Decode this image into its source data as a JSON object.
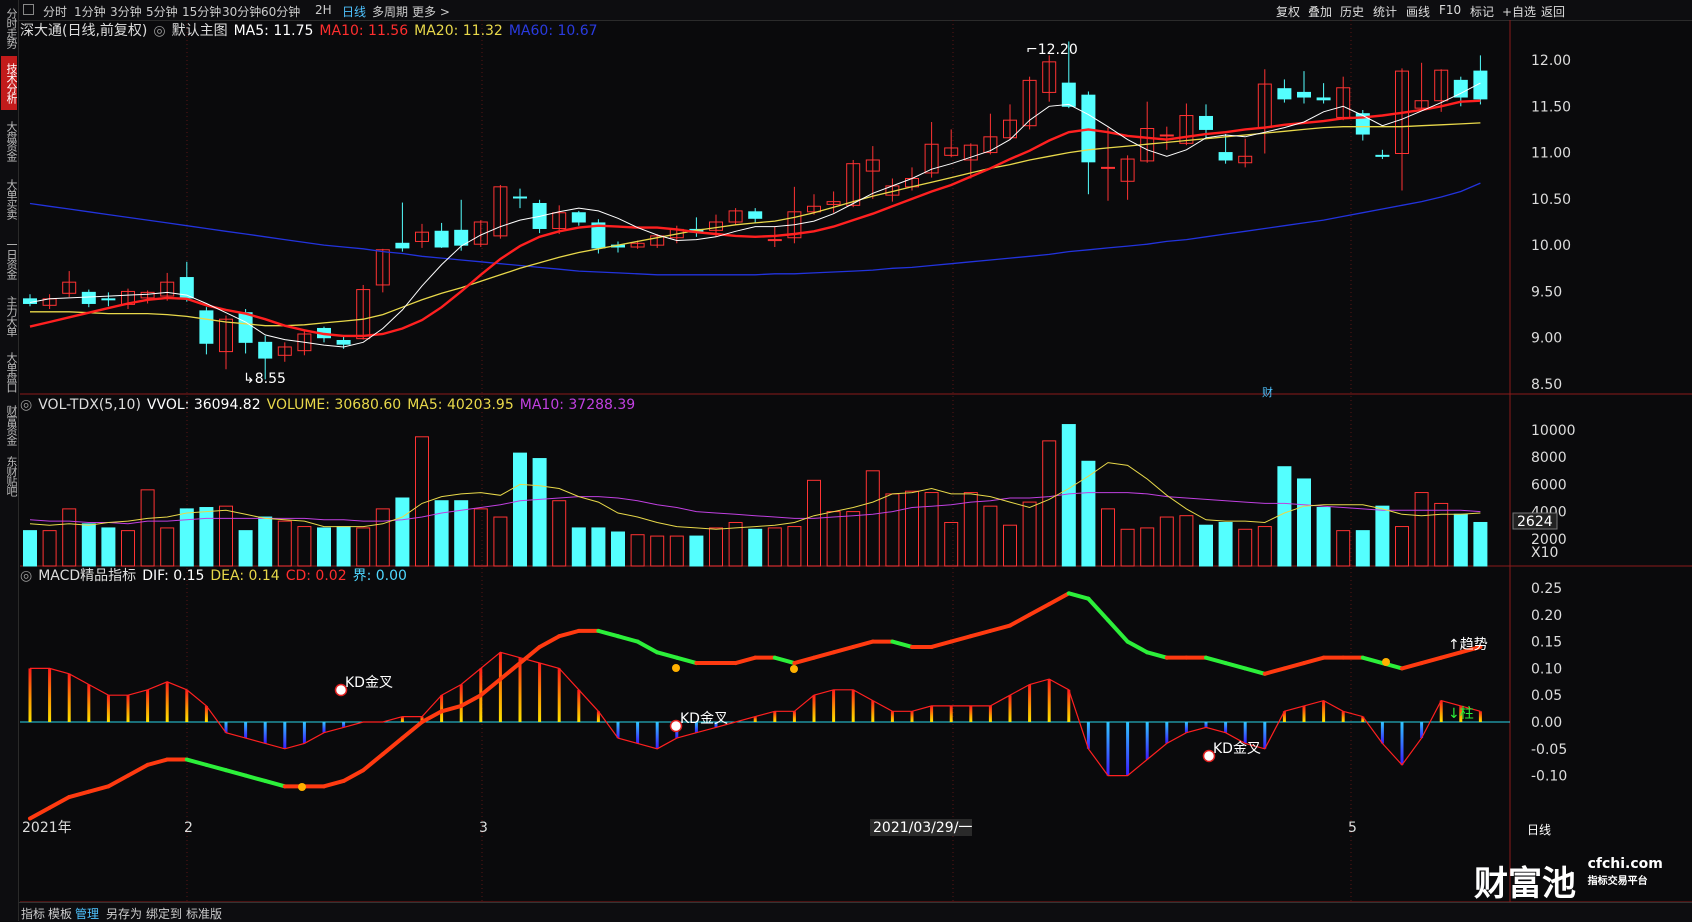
{
  "sidebar": [
    "分时走势",
    "技术分析",
    "大盘资金",
    "大单买卖",
    "一日资金",
    "主力大单",
    "大单盘口",
    "财富资金",
    "东财贴吧"
  ],
  "toolbar": {
    "periods": [
      "分时",
      "1分钟",
      "3分钟",
      "5分钟",
      "15分钟",
      "30分钟",
      "60分钟",
      "2H",
      "日线",
      "多周期",
      "更多 >"
    ],
    "selected": "日线",
    "right": [
      "复权",
      "叠加",
      "历史",
      "统计",
      "画线",
      "F10",
      "标记",
      "+自选",
      "返回"
    ]
  },
  "main_header": {
    "stock": "深大通(日线,前复权)",
    "template": "默认主图",
    "ma5": "MA5: 11.75",
    "ma10": "MA10: 11.56",
    "ma20": "MA20: 11.32",
    "ma60": "MA60: 10.67"
  },
  "vol_header": {
    "name": "VOL-TDX(5,10)",
    "vvol": "VVOL: 36094.82",
    "volume": "VOLUME: 30680.60",
    "ma5": "MA5: 40203.95",
    "ma10": "MA10: 37288.39"
  },
  "macd_header": {
    "name": "MACD精品指标",
    "dif": "DIF: 0.15",
    "dea": "DEA: 0.14",
    "cd": "CD: 0.02",
    "jie": "界: 0.00"
  },
  "price_axis": [
    "12.00",
    "11.50",
    "11.00",
    "10.50",
    "10.00",
    "9.50",
    "9.00",
    "8.50"
  ],
  "vol_axis": [
    "10000",
    "8000",
    "6000",
    "4000",
    "2000"
  ],
  "vol_cursor": "2624",
  "vol_unit": "X10",
  "macd_axis": [
    "0.25",
    "0.20",
    "0.15",
    "0.10",
    "0.05",
    "0.00",
    "-0.05",
    "-0.10"
  ],
  "annotations": {
    "high": "12.20",
    "low": "8.55",
    "cai": "财",
    "kd": "KD金叉",
    "trend": "↑趋势",
    "bar": "↓柱"
  },
  "x_labels": [
    "2021年",
    "2",
    "3",
    "2021/03/29/一",
    "5"
  ],
  "x_right": "日线",
  "bottom_tabs": [
    "指标",
    "模板",
    "管理",
    "另存为",
    "绑定到",
    "标准版"
  ],
  "bottom_selected": "管理",
  "logo": {
    "main": "财富池",
    "domain": "cfchi.com",
    "sub": "指标交易平台"
  },
  "colors": {
    "up": "#ff3333",
    "down": "#54ffff",
    "ma5": "#ffffff",
    "ma10": "#ff2020",
    "ma20": "#e8d84a",
    "ma60": "#2233dd",
    "vma5": "#e8d84a",
    "vma10": "#c040e0"
  },
  "chart_data": {
    "type": "candlestick",
    "candles": [
      [
        9.42,
        9.37,
        9.47,
        9.34
      ],
      [
        9.35,
        9.42,
        9.47,
        9.31
      ],
      [
        9.48,
        9.6,
        9.72,
        9.44
      ],
      [
        9.49,
        9.37,
        9.52,
        9.33
      ],
      [
        9.42,
        9.41,
        9.49,
        9.34
      ],
      [
        9.36,
        9.5,
        9.53,
        9.31
      ],
      [
        9.43,
        9.49,
        9.51,
        9.37
      ],
      [
        9.45,
        9.6,
        9.7,
        9.4
      ],
      [
        9.65,
        9.43,
        9.82,
        9.39
      ],
      [
        9.29,
        8.94,
        9.33,
        8.82
      ],
      [
        8.85,
        9.2,
        9.24,
        8.66
      ],
      [
        9.27,
        8.95,
        9.31,
        8.83
      ],
      [
        8.95,
        8.78,
        9.02,
        8.55
      ],
      [
        8.81,
        8.9,
        8.95,
        8.74
      ],
      [
        8.86,
        9.04,
        9.09,
        8.81
      ],
      [
        9.1,
        9.0,
        9.12,
        8.95
      ],
      [
        8.97,
        8.93,
        9.02,
        8.88
      ],
      [
        8.99,
        9.52,
        9.57,
        8.98
      ],
      [
        9.57,
        9.95,
        9.96,
        9.49
      ],
      [
        10.02,
        9.97,
        10.46,
        9.93
      ],
      [
        10.04,
        10.14,
        10.23,
        9.97
      ],
      [
        10.15,
        9.98,
        10.24,
        9.97
      ],
      [
        10.16,
        10.0,
        10.49,
        9.94
      ],
      [
        10.01,
        10.25,
        10.27,
        9.98
      ],
      [
        10.1,
        10.63,
        10.65,
        10.07
      ],
      [
        10.52,
        10.51,
        10.61,
        10.4
      ],
      [
        10.45,
        10.18,
        10.49,
        10.13
      ],
      [
        10.18,
        10.35,
        10.43,
        10.12
      ],
      [
        10.35,
        10.25,
        10.37,
        10.21
      ],
      [
        10.24,
        9.97,
        10.28,
        9.91
      ],
      [
        10.0,
        9.98,
        10.04,
        9.92
      ],
      [
        9.98,
        10.02,
        10.05,
        9.96
      ],
      [
        10.0,
        10.1,
        10.12,
        9.97
      ],
      [
        10.08,
        10.17,
        10.21,
        10.02
      ],
      [
        10.17,
        10.14,
        10.3,
        10.09
      ],
      [
        10.16,
        10.25,
        10.33,
        10.09
      ],
      [
        10.25,
        10.37,
        10.4,
        10.22
      ],
      [
        10.36,
        10.29,
        10.4,
        10.24
      ],
      [
        10.06,
        10.06,
        10.2,
        9.98
      ],
      [
        10.08,
        10.36,
        10.63,
        10.02
      ],
      [
        10.36,
        10.42,
        10.55,
        10.33
      ],
      [
        10.44,
        10.47,
        10.58,
        10.35
      ],
      [
        10.43,
        10.88,
        10.92,
        10.41
      ],
      [
        10.8,
        10.92,
        11.07,
        10.5
      ],
      [
        10.54,
        10.64,
        10.72,
        10.47
      ],
      [
        10.63,
        10.72,
        10.84,
        10.59
      ],
      [
        10.78,
        11.09,
        11.33,
        10.73
      ],
      [
        10.97,
        11.05,
        11.25,
        10.95
      ],
      [
        10.92,
        11.08,
        11.1,
        10.72
      ],
      [
        11.0,
        11.17,
        11.42,
        10.98
      ],
      [
        11.16,
        11.35,
        11.52,
        11.14
      ],
      [
        11.29,
        11.78,
        11.82,
        11.25
      ],
      [
        11.65,
        11.98,
        12.05,
        11.55
      ],
      [
        11.75,
        11.5,
        12.2,
        11.48
      ],
      [
        11.62,
        10.9,
        11.66,
        10.55
      ],
      [
        10.84,
        10.84,
        11.27,
        10.48
      ],
      [
        10.69,
        10.93,
        10.97,
        10.49
      ],
      [
        10.91,
        11.26,
        11.55,
        10.89
      ],
      [
        11.18,
        11.19,
        11.28,
        11.03
      ],
      [
        11.1,
        11.4,
        11.53,
        11.08
      ],
      [
        11.39,
        11.25,
        11.52,
        11.16
      ],
      [
        11.0,
        10.92,
        11.2,
        10.88
      ],
      [
        10.89,
        10.96,
        11.15,
        10.84
      ],
      [
        11.27,
        11.74,
        11.9,
        10.99
      ],
      [
        11.69,
        11.58,
        11.79,
        11.54
      ],
      [
        11.65,
        11.6,
        11.88,
        11.53
      ],
      [
        11.59,
        11.57,
        11.75,
        11.53
      ],
      [
        11.38,
        11.7,
        11.82,
        11.35
      ],
      [
        11.42,
        11.2,
        11.46,
        11.13
      ],
      [
        10.97,
        10.96,
        11.03,
        10.93
      ],
      [
        10.99,
        11.88,
        11.91,
        10.59
      ],
      [
        11.48,
        11.56,
        11.97,
        11.46
      ],
      [
        11.56,
        11.89,
        11.9,
        11.44
      ],
      [
        11.78,
        11.6,
        11.82,
        11.5
      ],
      [
        11.88,
        11.58,
        12.05,
        11.52
      ]
    ],
    "ma5": [
      9.38,
      9.42,
      9.43,
      9.44,
      9.45,
      9.46,
      9.47,
      9.49,
      9.46,
      9.37,
      9.27,
      9.17,
      9.03,
      8.98,
      8.95,
      8.92,
      8.9,
      8.95,
      9.1,
      9.3,
      9.56,
      9.79,
      9.99,
      10.11,
      10.2,
      10.27,
      10.31,
      10.36,
      10.4,
      10.37,
      10.29,
      10.19,
      10.11,
      10.05,
      10.06,
      10.09,
      10.15,
      10.2,
      10.2,
      10.22,
      10.26,
      10.34,
      10.45,
      10.56,
      10.64,
      10.72,
      10.82,
      10.88,
      10.95,
      11.02,
      11.14,
      11.35,
      11.5,
      11.52,
      11.41,
      11.28,
      11.14,
      11.03,
      10.96,
      11.03,
      11.16,
      11.19,
      11.17,
      11.22,
      11.27,
      11.33,
      11.44,
      11.5,
      11.4,
      11.29,
      11.36,
      11.45,
      11.54,
      11.64,
      11.75
    ],
    "ma10": [
      9.12,
      9.17,
      9.22,
      9.27,
      9.32,
      9.37,
      9.41,
      9.43,
      9.42,
      9.35,
      9.3,
      9.26,
      9.2,
      9.13,
      9.08,
      9.04,
      9.02,
      9.02,
      9.04,
      9.1,
      9.19,
      9.33,
      9.5,
      9.68,
      9.85,
      9.99,
      10.09,
      10.15,
      10.19,
      10.21,
      10.2,
      10.19,
      10.19,
      10.17,
      10.14,
      10.12,
      10.1,
      10.09,
      10.1,
      10.12,
      10.15,
      10.2,
      10.27,
      10.34,
      10.42,
      10.5,
      10.58,
      10.65,
      10.74,
      10.83,
      10.93,
      11.02,
      11.13,
      11.22,
      11.25,
      11.22,
      11.18,
      11.16,
      11.14,
      11.17,
      11.2,
      11.22,
      11.25,
      11.27,
      11.3,
      11.32,
      11.34,
      11.37,
      11.38,
      11.4,
      11.43,
      11.46,
      11.5,
      11.55,
      11.56
    ],
    "ma20": [
      9.28,
      9.28,
      9.28,
      9.27,
      9.26,
      9.26,
      9.26,
      9.25,
      9.23,
      9.2,
      9.17,
      9.15,
      9.13,
      9.13,
      9.14,
      9.16,
      9.18,
      9.2,
      9.25,
      9.33,
      9.41,
      9.48,
      9.54,
      9.61,
      9.68,
      9.75,
      9.81,
      9.87,
      9.92,
      9.96,
      10.0,
      10.04,
      10.08,
      10.12,
      10.16,
      10.19,
      10.22,
      10.24,
      10.26,
      10.3,
      10.35,
      10.41,
      10.47,
      10.53,
      10.58,
      10.63,
      10.68,
      10.73,
      10.78,
      10.83,
      10.87,
      10.92,
      10.96,
      11.0,
      11.03,
      11.05,
      11.07,
      11.09,
      11.11,
      11.13,
      11.15,
      11.17,
      11.19,
      11.21,
      11.23,
      11.25,
      11.27,
      11.28,
      11.28,
      11.28,
      11.28,
      11.29,
      11.3,
      11.31,
      11.32
    ],
    "ma60": [
      10.45,
      10.42,
      10.39,
      10.36,
      10.33,
      10.3,
      10.27,
      10.24,
      10.21,
      10.18,
      10.15,
      10.12,
      10.09,
      10.06,
      10.03,
      10.0,
      9.98,
      9.96,
      9.93,
      9.91,
      9.88,
      9.86,
      9.84,
      9.82,
      9.8,
      9.78,
      9.76,
      9.74,
      9.72,
      9.71,
      9.7,
      9.69,
      9.68,
      9.68,
      9.68,
      9.68,
      9.68,
      9.68,
      9.69,
      9.69,
      9.7,
      9.71,
      9.72,
      9.73,
      9.75,
      9.76,
      9.78,
      9.8,
      9.82,
      9.84,
      9.86,
      9.88,
      9.9,
      9.93,
      9.95,
      9.97,
      9.99,
      10.01,
      10.04,
      10.06,
      10.09,
      10.12,
      10.15,
      10.18,
      10.21,
      10.24,
      10.27,
      10.31,
      10.35,
      10.39,
      10.43,
      10.47,
      10.52,
      10.58,
      10.67
    ],
    "volumes": [
      2600,
      2600,
      4200,
      3100,
      2800,
      2600,
      5600,
      2800,
      4200,
      4300,
      4400,
      2600,
      3600,
      3300,
      2900,
      2800,
      2900,
      2800,
      4200,
      5000,
      9500,
      4800,
      4800,
      4200,
      3600,
      8300,
      7900,
      4800,
      2800,
      2800,
      2500,
      2300,
      2200,
      2200,
      2200,
      2800,
      3200,
      2700,
      2800,
      2900,
      6300,
      4000,
      4000,
      7000,
      5300,
      5500,
      5400,
      3200,
      5400,
      4400,
      3000,
      4700,
      9200,
      10400,
      7700,
      4200,
      2700,
      2800,
      3600,
      3700,
      3000,
      3200,
      2700,
      2900,
      7300,
      6400,
      4300,
      2600,
      2600,
      4400,
      2900,
      5400,
      4600,
      3800,
      3200
    ],
    "vol_ma5": [
      3100,
      3000,
      3100,
      3000,
      3200,
      3300,
      3500,
      3600,
      3900,
      4000,
      4100,
      3800,
      3500,
      3400,
      3300,
      2900,
      2900,
      2900,
      3100,
      3600,
      4600,
      5100,
      5300,
      5400,
      5200,
      6000,
      5900,
      5700,
      5100,
      4700,
      3900,
      3600,
      3200,
      2900,
      2800,
      2700,
      2800,
      2900,
      3000,
      3200,
      3700,
      4000,
      4300,
      4700,
      5300,
      5400,
      5700,
      5300,
      5300,
      5100,
      4700,
      4300,
      4900,
      5700,
      6600,
      7600,
      7400,
      6400,
      5200,
      4200,
      3400,
      3300,
      3300,
      3200,
      3900,
      4400,
      4500,
      4500,
      4500,
      4200,
      3800,
      3700,
      3800,
      3800,
      3900
    ],
    "vol_ma10": [
      3400,
      3300,
      3300,
      3200,
      3200,
      3100,
      3300,
      3300,
      3400,
      3500,
      3500,
      3500,
      3500,
      3500,
      3500,
      3400,
      3400,
      3300,
      3300,
      3400,
      3600,
      3900,
      4100,
      4300,
      4500,
      4800,
      4900,
      5000,
      5100,
      5100,
      5000,
      4800,
      4500,
      4300,
      4000,
      3900,
      3800,
      3700,
      3600,
      3500,
      3500,
      3600,
      3700,
      3800,
      4000,
      4300,
      4400,
      4500,
      4700,
      4800,
      5000,
      5000,
      5100,
      5300,
      5400,
      5400,
      5400,
      5300,
      5100,
      5000,
      4900,
      4800,
      4700,
      4600,
      4600,
      4500,
      4400,
      4300,
      4200,
      4100,
      4100,
      4100,
      4100,
      4100,
      4000
    ],
    "macd_bar": [
      0.1,
      0.1,
      0.09,
      0.07,
      0.05,
      0.05,
      0.06,
      0.075,
      0.06,
      0.03,
      -0.02,
      -0.03,
      -0.04,
      -0.05,
      -0.04,
      -0.02,
      -0.01,
      0.0,
      0.0,
      0.01,
      0.01,
      0.05,
      0.07,
      0.1,
      0.13,
      0.12,
      0.11,
      0.1,
      0.06,
      0.02,
      -0.03,
      -0.04,
      -0.05,
      -0.03,
      -0.02,
      -0.01,
      0.0,
      0.01,
      0.02,
      0.02,
      0.05,
      0.06,
      0.06,
      0.04,
      0.02,
      0.02,
      0.03,
      0.03,
      0.03,
      0.03,
      0.05,
      0.07,
      0.08,
      0.06,
      -0.05,
      -0.1,
      -0.1,
      -0.07,
      -0.04,
      -0.02,
      -0.01,
      -0.02,
      -0.04,
      -0.05,
      0.02,
      0.03,
      0.04,
      0.02,
      0.01,
      -0.04,
      -0.08,
      -0.03,
      0.04,
      0.03,
      0.02
    ],
    "trend_line": [
      -0.18,
      -0.16,
      -0.14,
      -0.13,
      -0.12,
      -0.1,
      -0.08,
      -0.07,
      -0.07,
      -0.08,
      -0.09,
      -0.1,
      -0.11,
      -0.12,
      -0.12,
      -0.12,
      -0.11,
      -0.09,
      -0.06,
      -0.03,
      0.0,
      0.02,
      0.03,
      0.05,
      0.08,
      0.11,
      0.14,
      0.16,
      0.17,
      0.17,
      0.16,
      0.15,
      0.13,
      0.12,
      0.11,
      0.11,
      0.11,
      0.12,
      0.12,
      0.11,
      0.12,
      0.13,
      0.14,
      0.15,
      0.15,
      0.14,
      0.14,
      0.15,
      0.16,
      0.17,
      0.18,
      0.2,
      0.22,
      0.24,
      0.23,
      0.19,
      0.15,
      0.13,
      0.12,
      0.12,
      0.12,
      0.11,
      0.1,
      0.09,
      0.1,
      0.11,
      0.12,
      0.12,
      0.12,
      0.11,
      0.1,
      0.11,
      0.12,
      0.13,
      0.14
    ]
  }
}
